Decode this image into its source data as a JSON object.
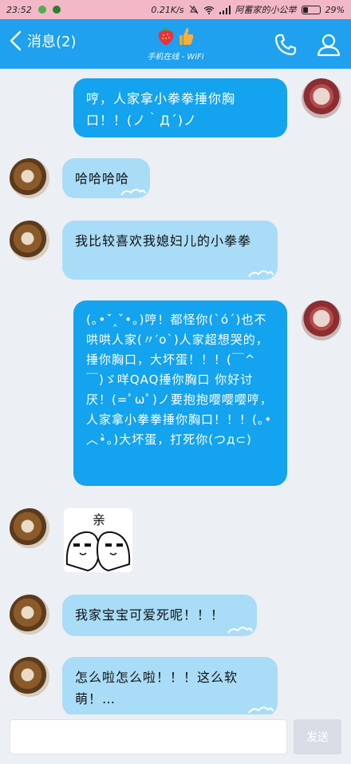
{
  "status_bar": {
    "time": "23:52",
    "speed": "0.21K/s",
    "carrier": "阿蓄家的小公举",
    "battery": "29%"
  },
  "header": {
    "back_label": "消息(2)",
    "subtitle": "手机在线 - WiFi",
    "accent": "#1fa1f0"
  },
  "messages": [
    {
      "from": "me",
      "text": "哼，人家拿小拳拳捶你胸口！！(ノ｀Д´)ノ"
    },
    {
      "from": "friend",
      "text": "哈哈哈哈"
    },
    {
      "from": "friend",
      "text": "我比较喜欢我媳妇儿的小拳拳"
    },
    {
      "from": "me",
      "text": "(｡•ˇ‸ˇ•｡)哼！都怪你(`ó´)也不哄哄人家(〃′o`)人家超想哭的，捶你胸口，大坏蛋！！！(￣^￣)ゞ咩QAQ捶你胸口 你好讨厌！(=ﾟωﾟ)ノ要抱抱嘤嘤嘤哼，人家拿小拳拳捶你胸口！！！(｡• ︿•̀｡)大坏蛋，打死你(つд⊂)"
    },
    {
      "from": "friend",
      "type": "sticker",
      "text": "亲"
    },
    {
      "from": "friend",
      "text": "我家宝宝可爱死呢！！！"
    },
    {
      "from": "friend",
      "text": "怎么啦怎么啦！！！这么软萌！…"
    }
  ],
  "input": {
    "value": "",
    "send_label": "发送"
  },
  "colors": {
    "my_bubble": "#14a3ee",
    "friend_bubble": "#a9dcf7",
    "background": "#eceff4"
  }
}
